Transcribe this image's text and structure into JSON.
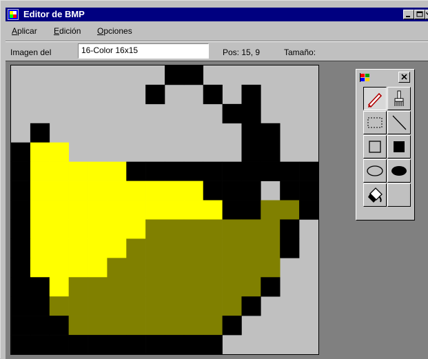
{
  "window": {
    "title": "Editor de BMP"
  },
  "menu": [
    {
      "prefix": "",
      "accel": "A",
      "rest": "plicar"
    },
    {
      "prefix": "",
      "accel": "E",
      "rest": "dición"
    },
    {
      "prefix": "",
      "accel": "O",
      "rest": "pciones"
    }
  ],
  "info": {
    "label": "Imagen del",
    "image_name": "16-Color 16x15",
    "position": "Pos: 15, 9",
    "size": "Tamaño:"
  },
  "image": {
    "width": 16,
    "height": 15,
    "palette": {
      "0": "#000000",
      "1": "#ffff00",
      "2": "#808000",
      "3": "#c0c0c0"
    },
    "rows": [
      "3333333300333333",
      "3333333033030333",
      "3333333333300333",
      "3033333333330033",
      "0113333333330033",
      "0111110000000000",
      "0111111111000300",
      "0111111111100220",
      "0111111222222203",
      "0111112222222203",
      "0111122222222233",
      "0012222222222033",
      "0022222222220333",
      "0002222222203333",
      "0000000000033333"
    ]
  },
  "toolbox": {
    "tools": [
      {
        "name": "pencil",
        "active": true
      },
      {
        "name": "brush",
        "active": false
      },
      {
        "name": "select",
        "active": false
      },
      {
        "name": "line",
        "active": false
      },
      {
        "name": "rect",
        "active": false
      },
      {
        "name": "filled-rect",
        "active": false
      },
      {
        "name": "ellipse",
        "active": false
      },
      {
        "name": "filled-ellipse",
        "active": false
      },
      {
        "name": "fill",
        "active": false
      },
      {
        "name": "empty",
        "active": false
      }
    ]
  },
  "colors": {
    "title_bar": "#000080",
    "face": "#c0c0c0",
    "workspace": "#808080"
  }
}
